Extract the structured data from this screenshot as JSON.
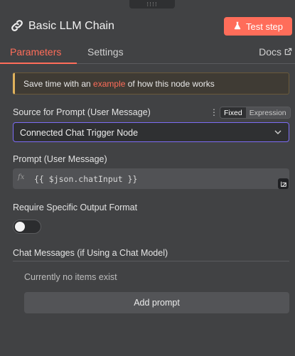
{
  "node": {
    "title": "Basic LLM Chain",
    "title_icon": "link-icon",
    "test_button": {
      "label": "Test step",
      "icon": "flask-icon"
    },
    "drag_handle_icon": "drag-dots-icon"
  },
  "tabs": [
    {
      "label": "Parameters",
      "active": true
    },
    {
      "label": "Settings",
      "active": false
    }
  ],
  "docs": {
    "label": "Docs",
    "icon": "external-link-icon"
  },
  "notice": {
    "before": "Save time with an ",
    "link": "example",
    "after": " of how this node works"
  },
  "source_prompt": {
    "label": "Source for Prompt (User Message)",
    "options_icon": "kebab-icon",
    "mode_options": [
      "Fixed",
      "Expression"
    ],
    "selected_mode": "Fixed",
    "value": "Connected Chat Trigger Node",
    "dropdown_icon": "chevron-down-icon"
  },
  "prompt_user_message": {
    "label": "Prompt (User Message)",
    "expression_marker": "fx",
    "value": "{{ $json.chatInput }}",
    "expand_icon": "expand-icon"
  },
  "output_format": {
    "label": "Require Specific Output Format",
    "enabled": false
  },
  "chat_messages": {
    "label": "Chat Messages (if Using a Chat Model)",
    "empty_text": "Currently no items exist",
    "add_button": "Add prompt"
  },
  "colors": {
    "accent": "#ff6d5a",
    "panel_bg": "#414244",
    "input_bg": "#2f3032",
    "focus_border": "#7c6cf5",
    "notice_border": "#e0b25c"
  }
}
